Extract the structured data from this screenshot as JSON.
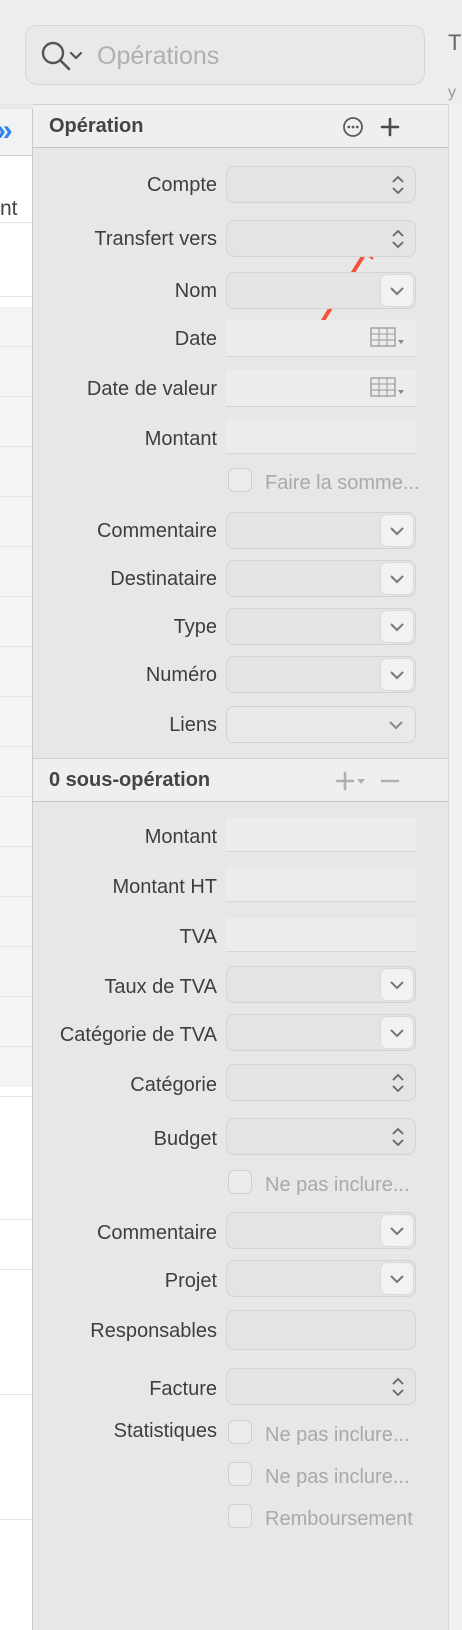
{
  "search": {
    "placeholder": "Opérations",
    "icon": "magnifier-chevron-icon"
  },
  "right_peek": {
    "char": "T",
    "char2": "y"
  },
  "list": {
    "header_fragment": "nt"
  },
  "operation": {
    "title": "Opération",
    "more_icon": "ellipsis-circle-icon",
    "add_icon": "plus-icon",
    "labels": {
      "account": "Compte",
      "transfer_to": "Transfert vers",
      "name": "Nom",
      "date": "Date",
      "value_date": "Date de valeur",
      "amount": "Montant",
      "sum_checkbox": "Faire la somme...",
      "comment": "Commentaire",
      "recipient": "Destinataire",
      "type": "Type",
      "number": "Numéro",
      "links": "Liens"
    }
  },
  "suboperations": {
    "title": "0 sous-opération",
    "add_icon": "plus-dropdown-icon",
    "remove_icon": "minus-icon",
    "labels": {
      "amount": "Montant",
      "amount_ht": "Montant HT",
      "vat": "TVA",
      "vat_rate": "Taux de TVA",
      "vat_category": "Catégorie de TVA",
      "category": "Catégorie",
      "budget": "Budget",
      "budget_checkbox": "Ne pas inclure...",
      "comment": "Commentaire",
      "project": "Projet",
      "owners": "Responsables",
      "invoice": "Facture",
      "statistics": "Statistiques",
      "stats_checkbox_1": "Ne pas inclure...",
      "stats_checkbox_2": "Ne pas inclure...",
      "reimbursement": "Remboursement"
    }
  },
  "colors": {
    "accent": "#2f86ef",
    "annotation_arrow": "#f0533a"
  }
}
